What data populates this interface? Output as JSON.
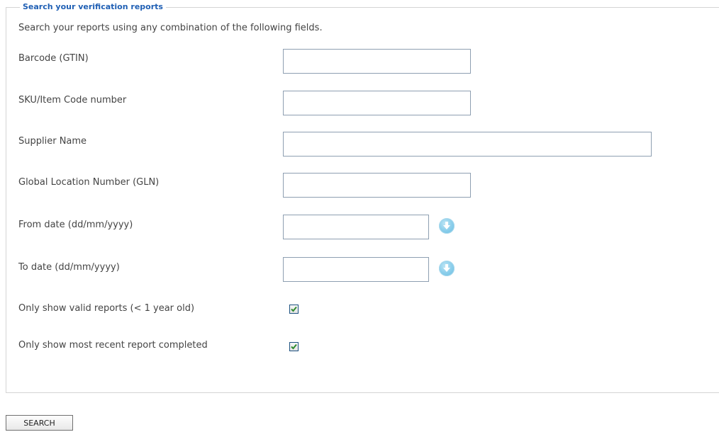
{
  "form": {
    "legend": "Search your verification reports",
    "intro": "Search your reports using any combination of the following fields.",
    "fields": [
      {
        "label": "Barcode (GTIN)",
        "value": ""
      },
      {
        "label": "SKU/Item Code number",
        "value": ""
      },
      {
        "label": "Supplier Name",
        "value": ""
      },
      {
        "label": "Global Location Number (GLN)",
        "value": ""
      },
      {
        "label": "From date (dd/mm/yyyy)",
        "value": ""
      },
      {
        "label": "To date (dd/mm/yyyy)",
        "value": ""
      }
    ],
    "checkboxes": [
      {
        "label": "Only show valid reports (< 1 year old)",
        "checked": true
      },
      {
        "label": "Only show most recent report completed",
        "checked": true
      }
    ],
    "search_label": "SEARCH",
    "icons": {
      "calendar": "calendar-dropdown-icon",
      "check": "checkmark-icon"
    },
    "colors": {
      "legend": "#1f5fb4",
      "text": "#444444",
      "input_border": "#8e9fb1",
      "check": "#2e8b2e"
    }
  }
}
